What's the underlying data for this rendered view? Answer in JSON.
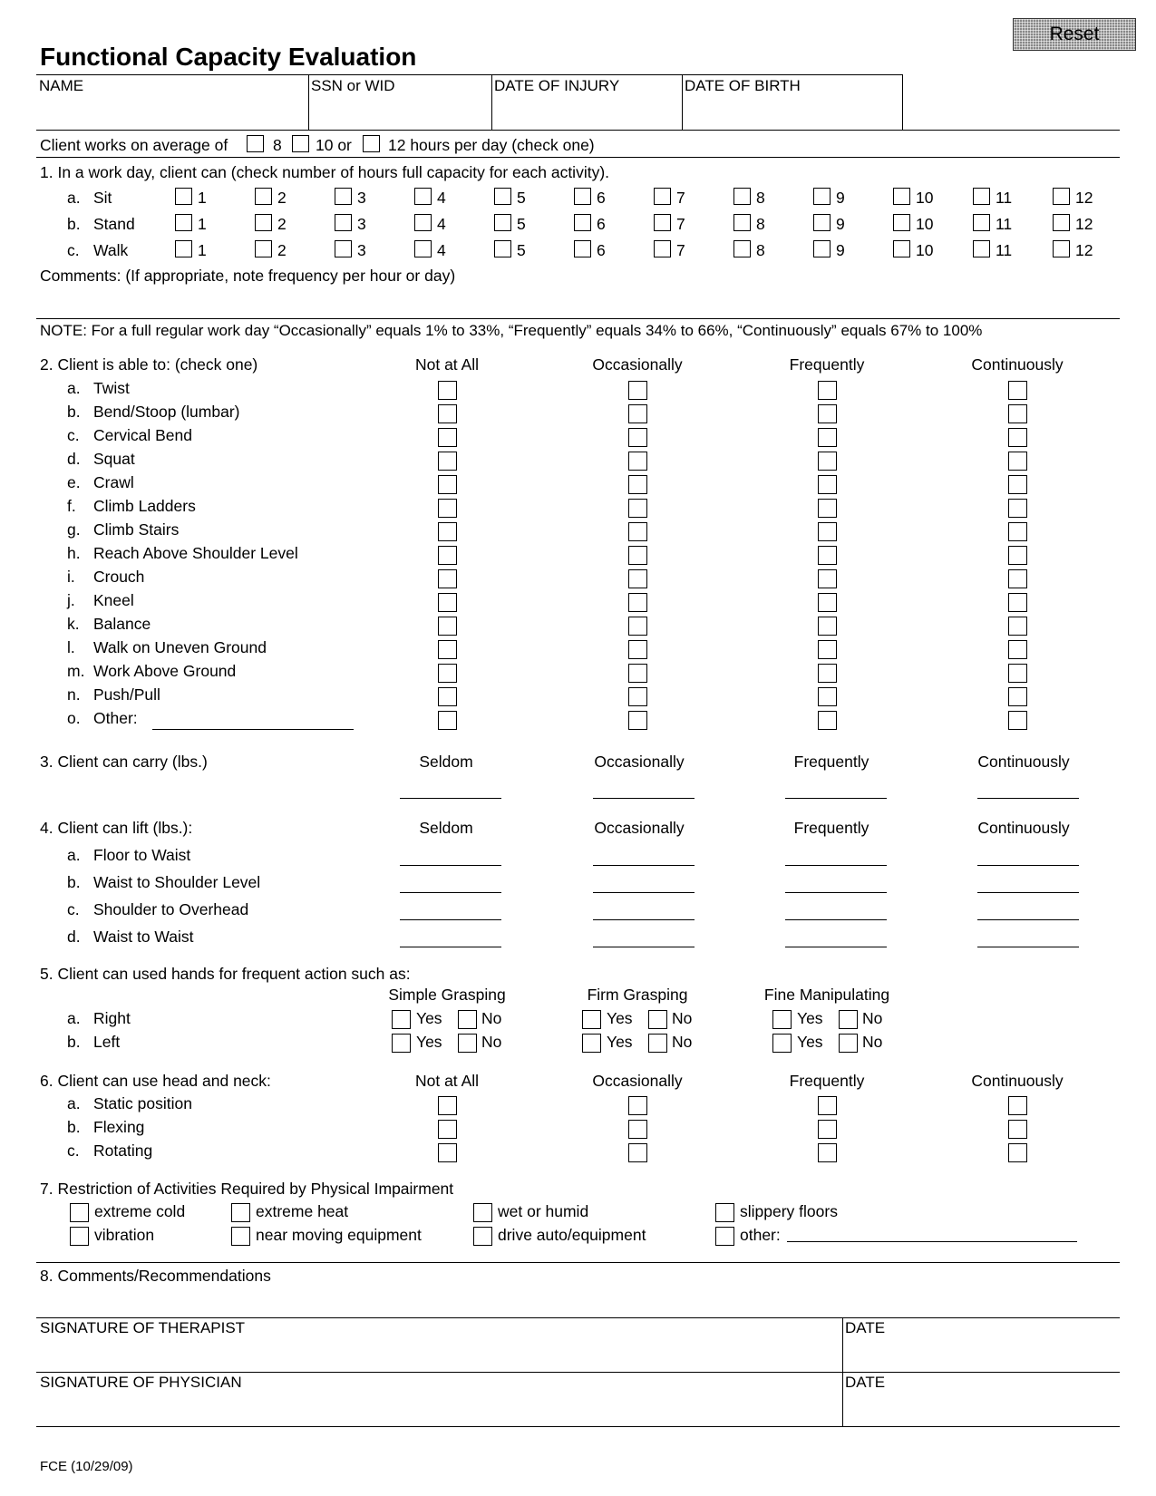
{
  "form": {
    "title": "Functional Capacity Evaluation",
    "reset_label": "Reset",
    "footer_code": "FCE (10/29/09)"
  },
  "header_fields": [
    {
      "label": "NAME",
      "value": ""
    },
    {
      "label": "SSN or WID",
      "value": ""
    },
    {
      "label": "DATE OF INJURY",
      "value": ""
    },
    {
      "label": "DATE OF BIRTH",
      "value": ""
    }
  ],
  "work_hours": {
    "prefix": "Client works on average of",
    "options": [
      "8",
      "10 or",
      "12 hours per day (check one)"
    ],
    "checked": null
  },
  "section1": {
    "title": "1.  In a work day, client can (check number of hours full capacity for each activity).",
    "hours": [
      "1",
      "2",
      "3",
      "4",
      "5",
      "6",
      "7",
      "8",
      "9",
      "10",
      "11",
      "12"
    ],
    "activities": [
      {
        "letter": "a.",
        "label": "Sit"
      },
      {
        "letter": "b.",
        "label": "Stand"
      },
      {
        "letter": "c.",
        "label": "Walk"
      }
    ],
    "comments_label": "Comments:  (If appropriate, note frequency per hour or day)"
  },
  "note": "NOTE:  For a full regular work day “Occasionally” equals 1% to 33%, “Frequently” equals 34% to 66%, “Continuously” equals 67% to 100%",
  "section2": {
    "title": "2.  Client is able to:  (check one)",
    "columns": [
      "Not at All",
      "Occasionally",
      "Frequently",
      "Continuously"
    ],
    "items": [
      {
        "letter": "a.",
        "label": "Twist"
      },
      {
        "letter": "b.",
        "label": "Bend/Stoop (lumbar)"
      },
      {
        "letter": "c.",
        "label": "Cervical Bend"
      },
      {
        "letter": "d.",
        "label": "Squat"
      },
      {
        "letter": "e.",
        "label": "Crawl"
      },
      {
        "letter": "f.",
        "label": "Climb Ladders"
      },
      {
        "letter": "g.",
        "label": "Climb Stairs"
      },
      {
        "letter": "h.",
        "label": "Reach Above Shoulder Level"
      },
      {
        "letter": "i.",
        "label": "Crouch"
      },
      {
        "letter": "j.",
        "label": "Kneel"
      },
      {
        "letter": "k.",
        "label": "Balance"
      },
      {
        "letter": "l.",
        "label": "Walk on Uneven Ground"
      },
      {
        "letter": "m.",
        "label": "Work Above Ground"
      },
      {
        "letter": "n.",
        "label": "Push/Pull"
      },
      {
        "letter": "o.",
        "label": "Other:"
      }
    ]
  },
  "section3": {
    "title": "3.  Client can carry (lbs.)",
    "columns": [
      "Seldom",
      "Occasionally",
      "Frequently",
      "Continuously"
    ]
  },
  "section4": {
    "title": "4.  Client can lift (lbs.):",
    "columns": [
      "Seldom",
      "Occasionally",
      "Frequently",
      "Continuously"
    ],
    "items": [
      {
        "letter": "a.",
        "label": "Floor to Waist"
      },
      {
        "letter": "b.",
        "label": "Waist to Shoulder Level"
      },
      {
        "letter": "c.",
        "label": "Shoulder to Overhead"
      },
      {
        "letter": "d.",
        "label": "Waist to Waist"
      }
    ]
  },
  "section5": {
    "title": "5.  Client can used hands for frequent action such as:",
    "columns": [
      "Simple Grasping",
      "Firm Grasping",
      "Fine Manipulating"
    ],
    "yes_label": "Yes",
    "no_label": "No",
    "items": [
      {
        "letter": "a.",
        "label": "Right"
      },
      {
        "letter": "b.",
        "label": "Left"
      }
    ]
  },
  "section6": {
    "title": "6.  Client can use head and neck:",
    "columns": [
      "Not at All",
      "Occasionally",
      "Frequently",
      "Continuously"
    ],
    "items": [
      {
        "letter": "a.",
        "label": "Static position"
      },
      {
        "letter": "b.",
        "label": "Flexing"
      },
      {
        "letter": "c.",
        "label": "Rotating"
      }
    ]
  },
  "section7": {
    "title": "7.  Restriction of Activities Required by Physical Impairment",
    "options": [
      "extreme cold",
      "extreme heat",
      "wet or humid",
      "slippery floors",
      "vibration",
      "near moving equipment",
      "drive auto/equipment",
      "other:"
    ]
  },
  "section8": {
    "title": "8.  Comments/Recommendations"
  },
  "signatures": [
    {
      "label": "SIGNATURE OF THERAPIST",
      "date_label": "DATE"
    },
    {
      "label": "SIGNATURE OF PHYSICIAN",
      "date_label": "DATE"
    }
  ]
}
